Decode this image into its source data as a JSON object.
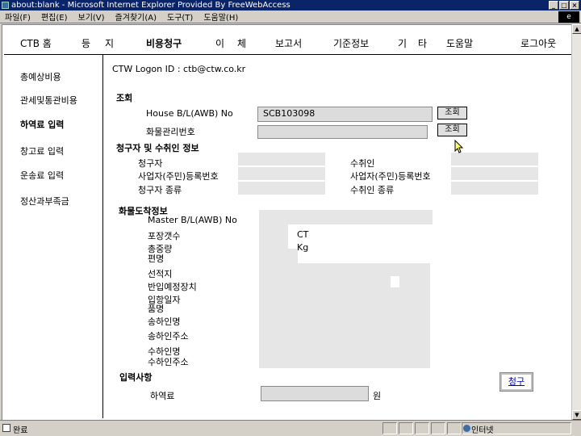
{
  "window": {
    "title": "about:blank - Microsoft Internet Explorer Provided By FreeWebAccess",
    "controls": [
      "_",
      "□",
      "×"
    ]
  },
  "menu": {
    "items": [
      "파일(F)",
      "편집(E)",
      "보기(V)",
      "즐겨찾기(A)",
      "도구(T)",
      "도움말(H)"
    ],
    "logo": "e"
  },
  "topnav": {
    "items": [
      "CTB 홈",
      "등",
      "지",
      "비용청구",
      "이",
      "체",
      "보고서",
      "기준정보",
      "기",
      "타",
      "도움말",
      "로그아웃"
    ]
  },
  "leftnav": {
    "items": [
      "총예상비용",
      "관세및통관비용",
      "하역료 입력",
      "창고료 입력",
      "운송료 입력",
      "정산과부족금"
    ]
  },
  "main": {
    "logon": "CTW Logon ID : ctb@ctw.co.kr",
    "inquiry": {
      "title": "조회",
      "bl_label": "House B/L(AWB) No",
      "bl_value": "SCB103098",
      "cargo_label": "화물관리번호",
      "cargo_value": "",
      "btn1": "조회",
      "btn2": "조회"
    },
    "claimant": {
      "title": "청구자 및 수취인 정보",
      "claimant_label": "청구자",
      "claimant_reg_label": "사업자(주민)등록번호",
      "claimant_type_label": "청구자 종류",
      "payee_label": "수취인",
      "payee_reg_label": "사업자(주민)등록번호",
      "payee_type_label": "수취인 종류"
    },
    "arrival": {
      "title": "화물도착정보",
      "master_bl": "Master B/L(AWB) No",
      "packages": "포장갯수",
      "packages_unit": "CT",
      "gross_weight": "총중량",
      "weight_unit": "Kg",
      "vessel": "편명",
      "loading_port": "선적지",
      "bonded_area": "반입예정장치",
      "arrival_date": "입항일자",
      "item_name": "품명",
      "shipper_name": "송하인명",
      "shipper_addr": "송하인주소",
      "consignee_name": "수하인명",
      "consignee_addr": "수하인주소"
    },
    "input": {
      "title": "입력사항",
      "fee_label": "하역료",
      "fee_value": "",
      "currency": "원",
      "submit": "청구"
    }
  },
  "status": {
    "text": "완료",
    "zone": "인터넷"
  }
}
